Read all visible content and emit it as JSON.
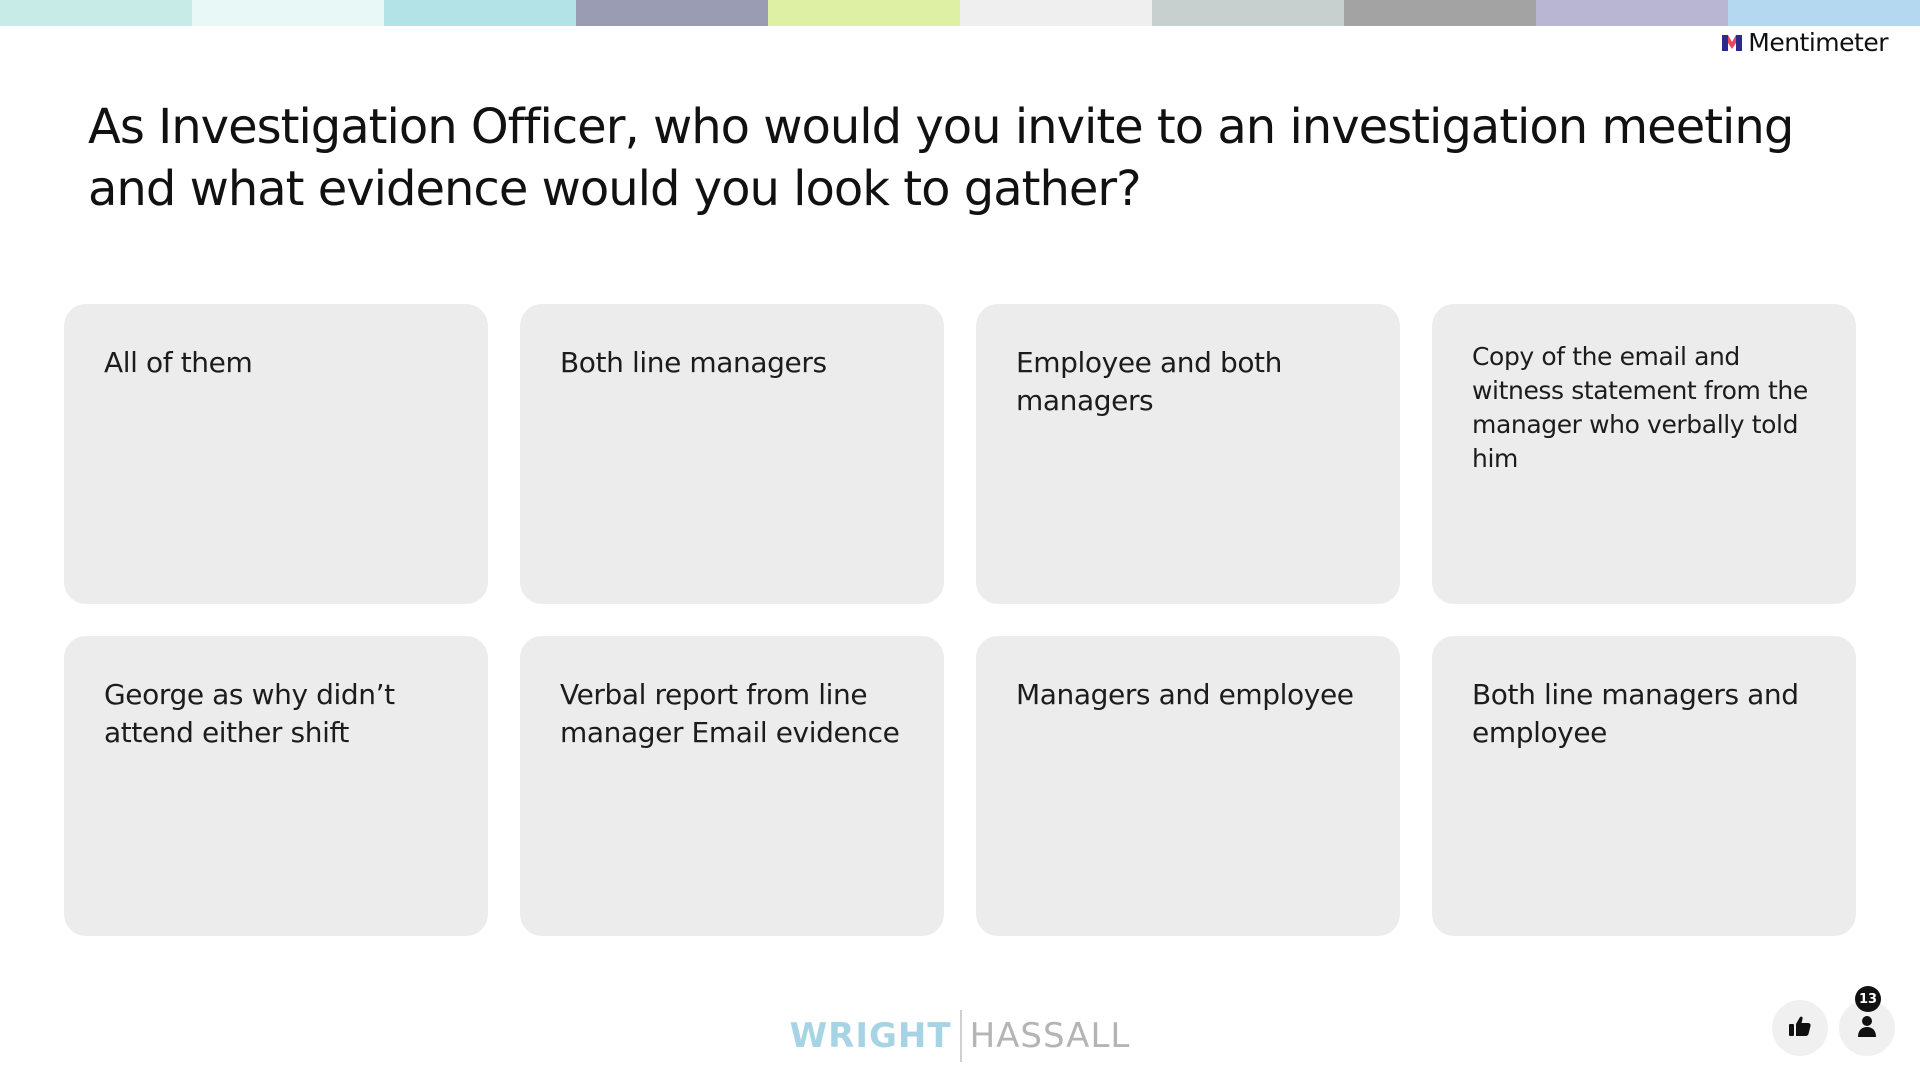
{
  "brand": {
    "name": "Mentimeter",
    "icon": "mentimeter-logo-icon"
  },
  "stripe_colors": [
    "#c7ebe6",
    "#e8f8f7",
    "#b3e3e6",
    "#9a9cb4",
    "#def0a3",
    "#efefef",
    "#c8d0cf",
    "#a3a3a3",
    "#b8b6d2",
    "#b4d8ef"
  ],
  "question": "As Investigation Officer, who would you invite to an investigation meeting and what evidence would you look to gather?",
  "responses": [
    "All of them",
    "Both line managers",
    "Employee and both managers",
    "Copy of the email and witness statement from the manager who verbally told him",
    "George as why didn’t attend either shift",
    "Verbal report from line manager Email evidence",
    "Managers and employee",
    "Both line managers and employee"
  ],
  "footer": {
    "logo_left": "WRIGHT",
    "logo_right": "HASSALL"
  },
  "controls": {
    "like_icon": "thumbs-up-icon",
    "participants_icon": "person-icon",
    "participant_count": "13"
  },
  "colors": {
    "card_bg": "#ececec",
    "logo_left": "#a7d4e4",
    "logo_right": "#b4b4b4"
  }
}
